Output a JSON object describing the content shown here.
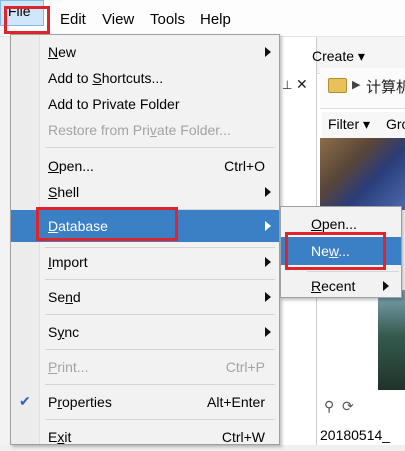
{
  "menubar": {
    "file": "File",
    "edit": "Edit",
    "view": "View",
    "tools": "Tools",
    "help": "Help"
  },
  "background": {
    "create_label": "Create ▾",
    "path_text": "计算机",
    "filter_label": "Filter ▾",
    "group_label": "Gro",
    "date_text": "20180514_"
  },
  "file_menu": {
    "new": "New",
    "add_to_shortcuts": "Add to Shortcuts...",
    "add_to_private_folder": "Add to Private Folder",
    "restore_from_private_folder": "Restore from Private Folder...",
    "open": "Open...",
    "open_shortcut": "Ctrl+O",
    "shell": "Shell",
    "database": "Database",
    "import": "Import",
    "send": "Send",
    "sync": "Sync",
    "print": "Print...",
    "print_shortcut": "Ctrl+P",
    "properties": "Properties",
    "properties_shortcut": "Alt+Enter",
    "exit": "Exit",
    "exit_shortcut": "Ctrl+W"
  },
  "database_submenu": {
    "open": "Open...",
    "new": "New...",
    "recent": "Recent"
  },
  "colors": {
    "highlight_box": "#e0242b",
    "active_item": "#3b7fc4"
  }
}
